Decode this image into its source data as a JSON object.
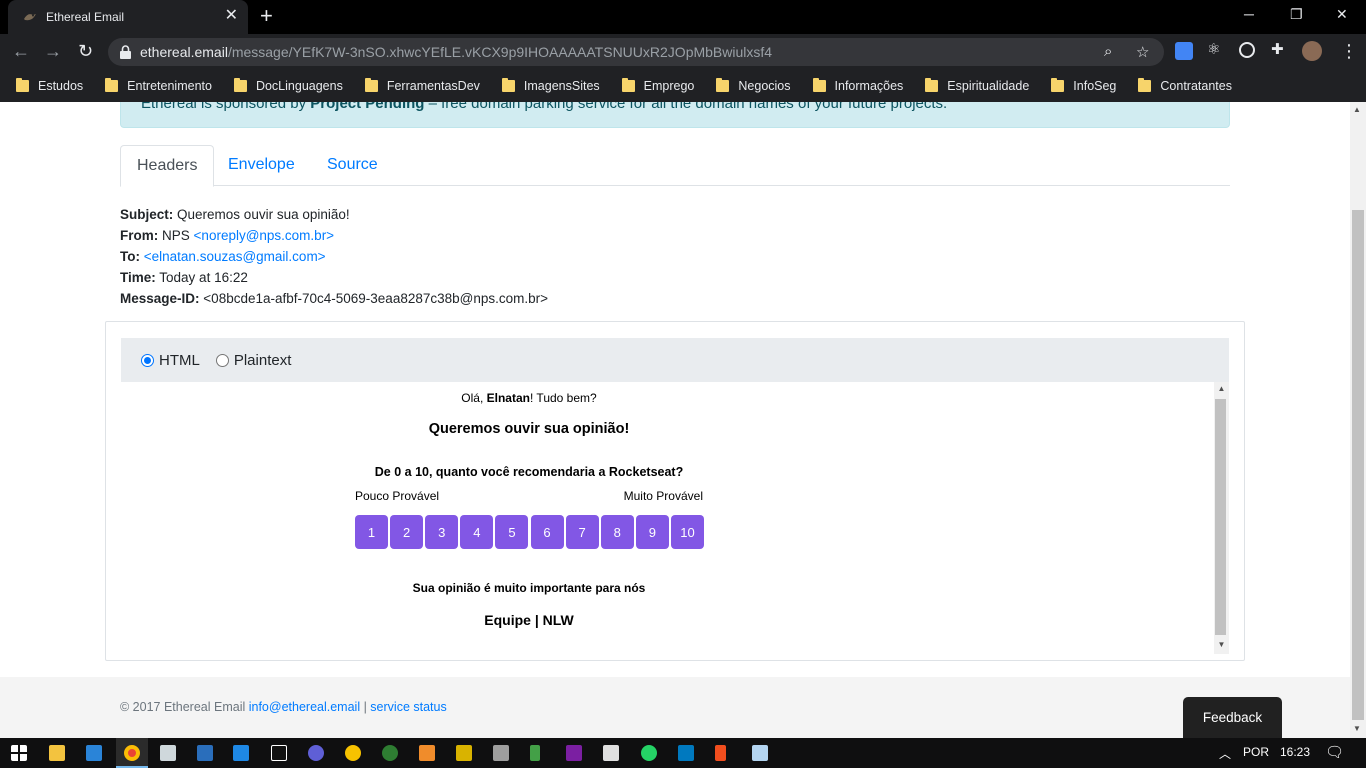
{
  "browser": {
    "tab_title": "Ethereal Email",
    "url_host": "ethereal.email",
    "url_path": "/message/YEfK7W-3nSO.xhwcYEfLE.vKCX9p9IHOAAAAATSNUUxR2JOpMbBwiulxsf4",
    "bookmarks": [
      "Estudos",
      "Entretenimento",
      "DocLinguagens",
      "FerramentasDev",
      "ImagensSites",
      "Emprego",
      "Negocios",
      "Informações",
      "Espiritualidade",
      "InfoSeg",
      "Contratantes"
    ]
  },
  "sponsor": {
    "prefix": "Ethereal is sponsored by ",
    "name": "Project Pending",
    "suffix": " – free domain parking service for all the domain names of your future projects."
  },
  "tabs": [
    "Headers",
    "Envelope",
    "Source"
  ],
  "headers": {
    "subject_label": "Subject:",
    "subject": "Queremos ouvir sua opinião!",
    "from_label": "From:",
    "from_name": "NPS",
    "from_email": "<noreply@nps.com.br>",
    "to_label": "To:",
    "to_email": "<elnatan.souzas@gmail.com>",
    "time_label": "Time:",
    "time": "Today at 16:22",
    "msgid_label": "Message-ID:",
    "msgid": "<08bcde1a-afbf-70c4-5069-3eaa8287c38b@nps.com.br>"
  },
  "view": {
    "html_label": "HTML",
    "plaintext_label": "Plaintext",
    "selected": "HTML"
  },
  "email": {
    "greet_prefix": "Olá, ",
    "greet_name": "Elnatan",
    "greet_suffix": "! Tudo bem?",
    "title": "Queremos ouvir sua opinião!",
    "question": "De 0 a 10, quanto você recomendaria a Rocketseat?",
    "low_label": "Pouco Provável",
    "high_label": "Muito Provável",
    "scores": [
      "1",
      "2",
      "3",
      "4",
      "5",
      "6",
      "7",
      "8",
      "9",
      "10"
    ],
    "note": "Sua opinião é muito importante para nós",
    "signature": "Equipe | NLW",
    "button_color": "#8257e5"
  },
  "footer": {
    "copyright": "© 2017 Ethereal Email ",
    "email_link": "info@ethereal.email",
    "separator": " | ",
    "status_link": "service status"
  },
  "feedback_label": "Feedback",
  "taskbar": {
    "language": "POR",
    "time": "16:23"
  }
}
